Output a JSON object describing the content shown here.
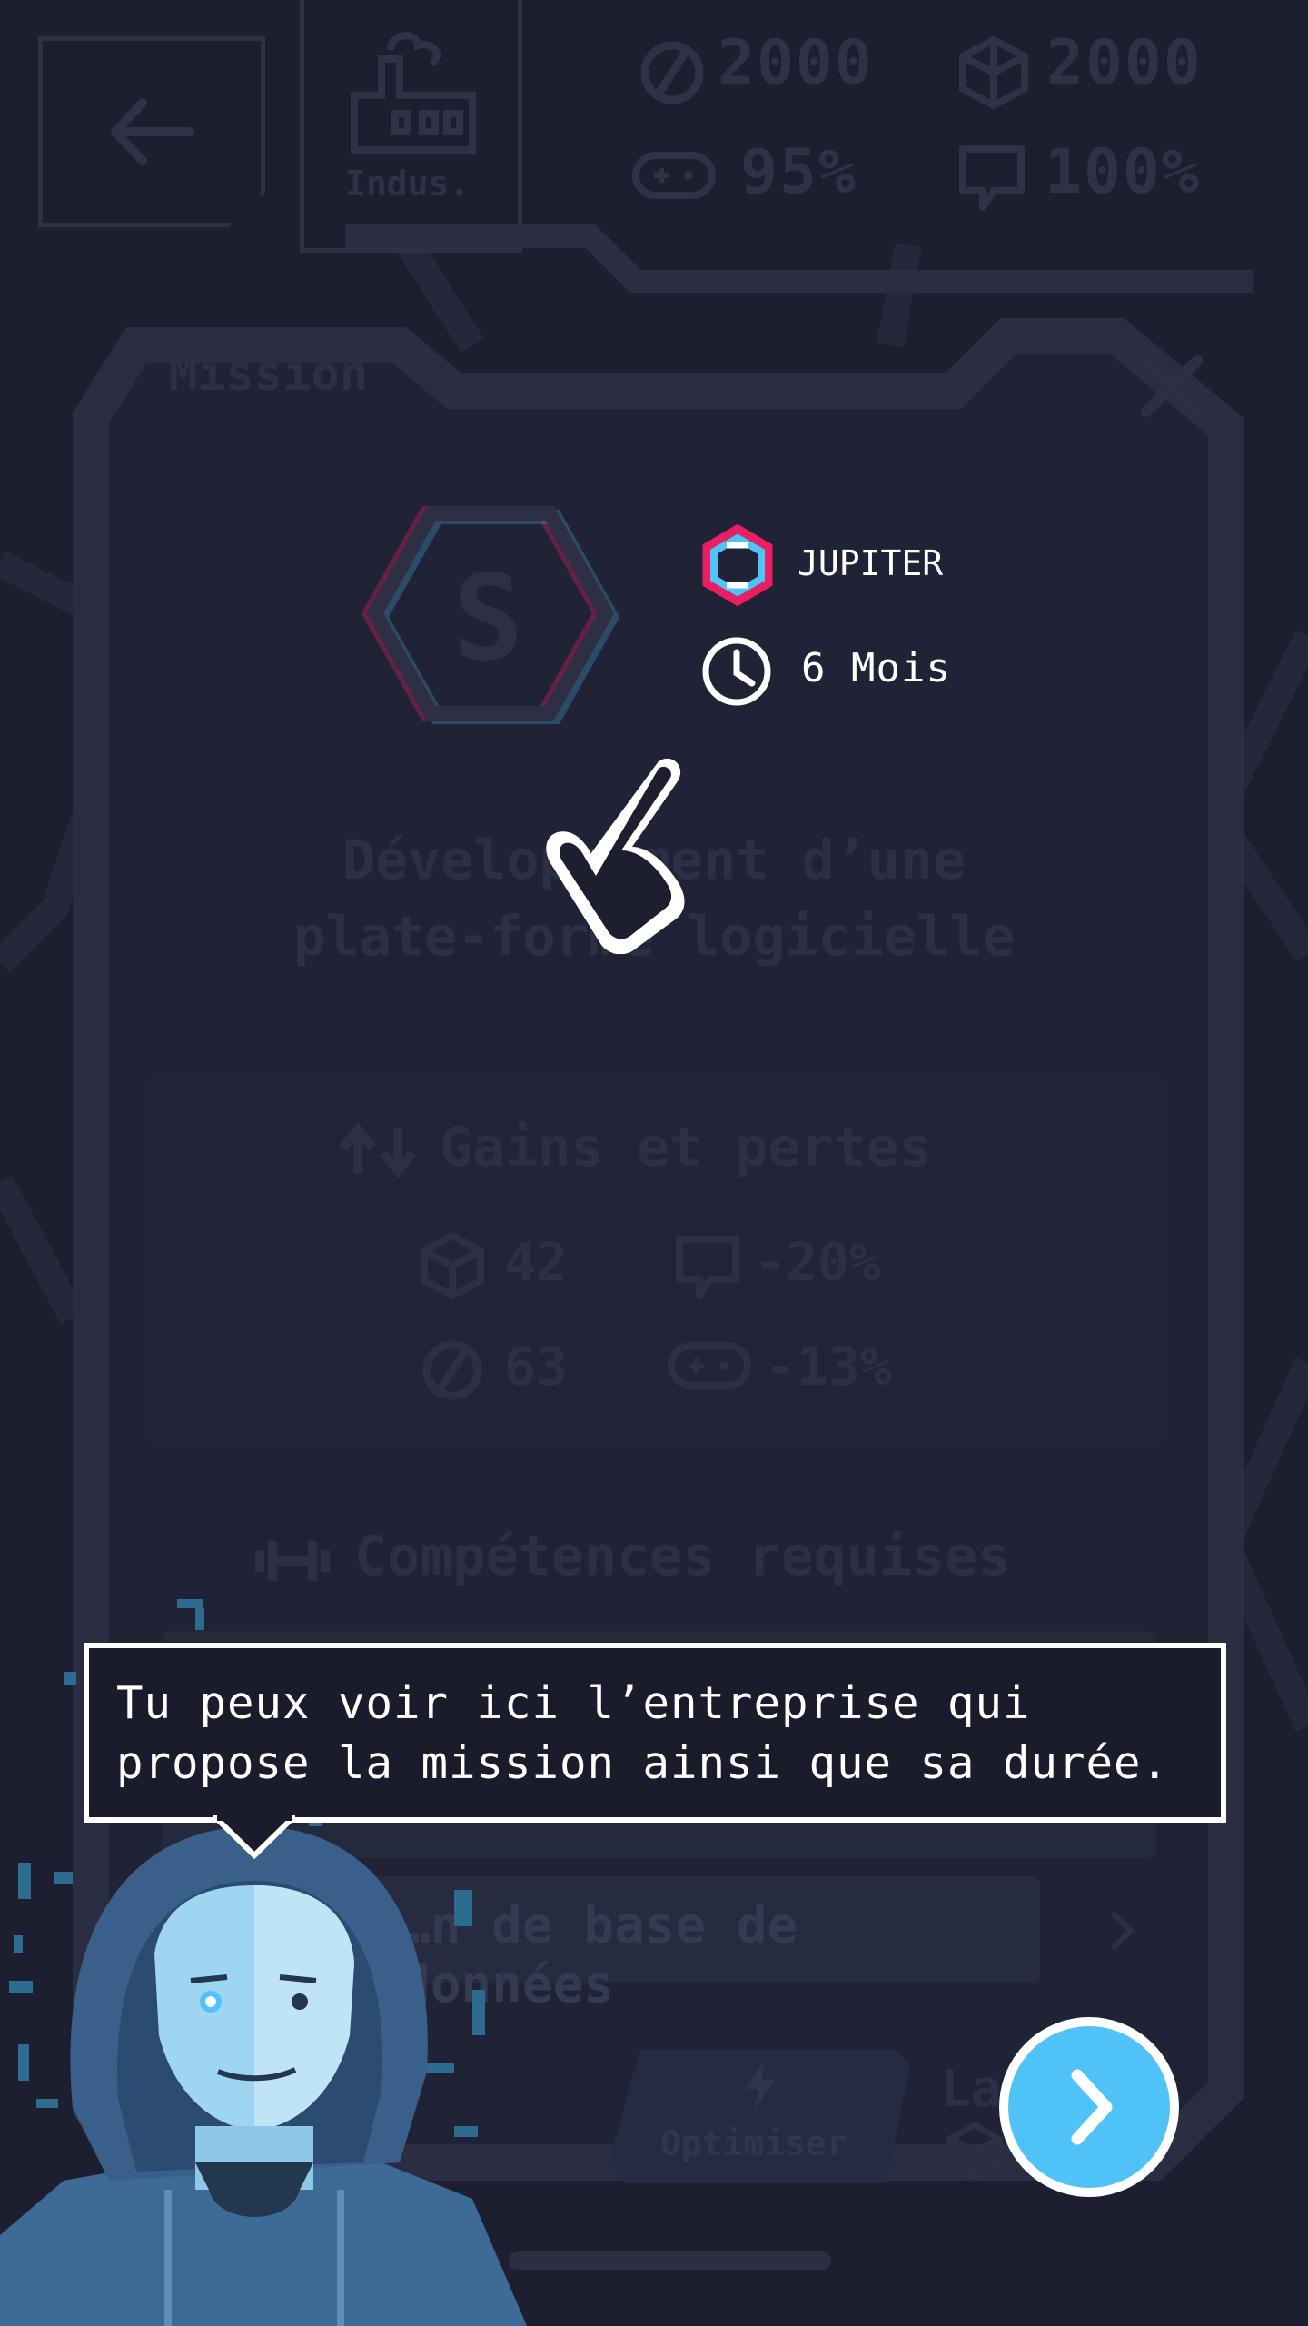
{
  "hud": {
    "building_label": "Indus.",
    "stats": [
      {
        "icon": "currency-icon",
        "value": "2000"
      },
      {
        "icon": "cube-icon",
        "value": "2000"
      },
      {
        "icon": "gamepad-icon",
        "value": "95%"
      },
      {
        "icon": "chat-icon",
        "value": "100%"
      }
    ]
  },
  "mission": {
    "title": "Mission",
    "rank": "S",
    "company": "JUPITER",
    "duration": "6 Mois",
    "name_line1": "Développement d’une",
    "name_line2": "plate-forme logicielle",
    "gains_title": "Gains et pertes",
    "gains": [
      {
        "icon": "cube-icon",
        "value": "42"
      },
      {
        "icon": "chat-icon",
        "value": "-20%"
      },
      {
        "icon": "currency-icon",
        "value": "63"
      },
      {
        "icon": "gamepad-icon",
        "value": "-13%"
      }
    ],
    "skills_title": "Compétences requises",
    "skill_item": "…n de base de données",
    "optimize_label": "Optimiser",
    "launch_label": "La…"
  },
  "tutorial": {
    "line1": "Tu peux voir ici l’entreprise qui",
    "line2": "propose la mission ainsi que sa durée."
  },
  "colors": {
    "background": "#1d1f30",
    "accent_blue": "#4fc3f7",
    "accent_pink": "#e91e63",
    "faded_text": "#2c3044"
  }
}
